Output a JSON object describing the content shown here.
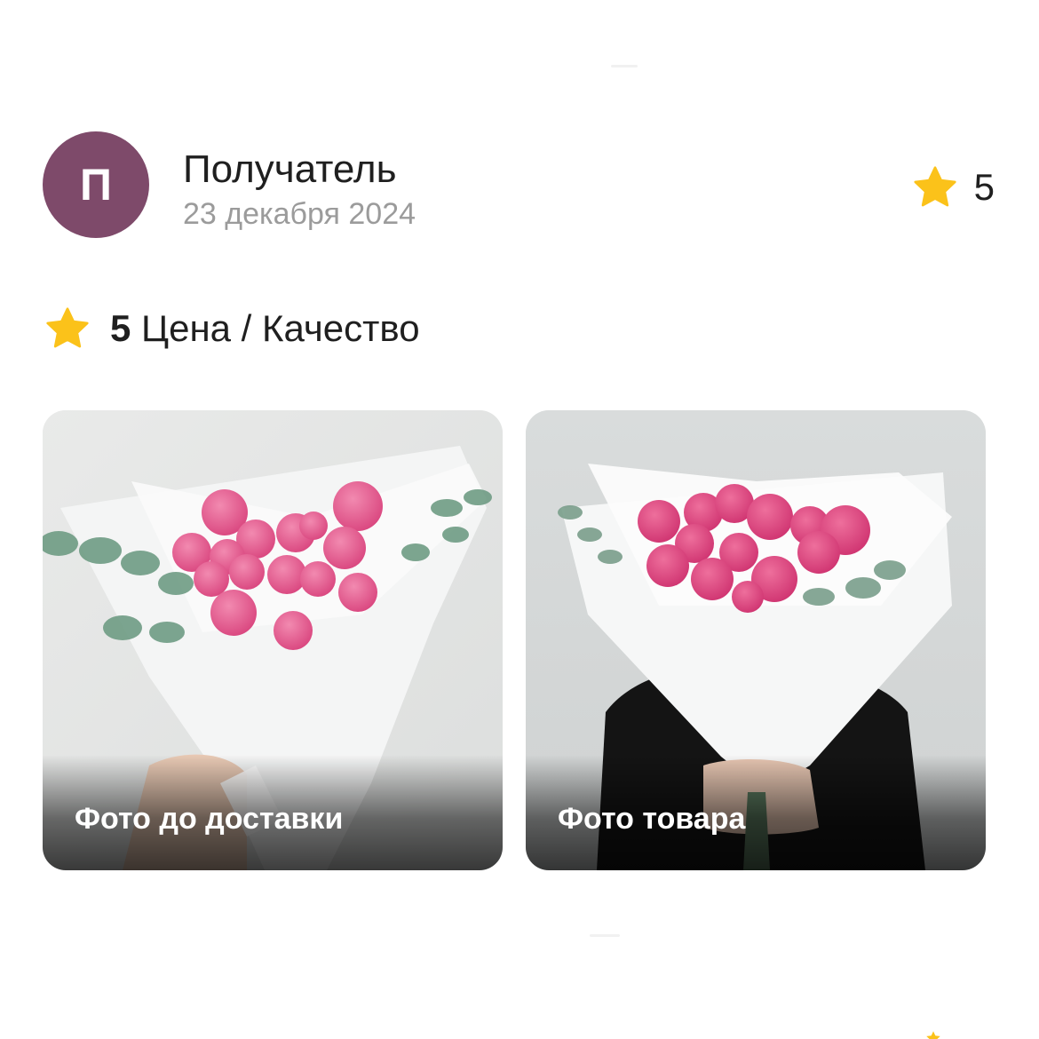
{
  "review": {
    "avatar_letter": "П",
    "author": "Получатель",
    "date": "23 декабря 2024",
    "rating": "5",
    "aspect": {
      "value": "5",
      "label": "Цена / Качество"
    },
    "photos": [
      {
        "caption": "Фото до доставки",
        "icon": "bouquet-photo"
      },
      {
        "caption": "Фото товара",
        "icon": "bouquet-photo"
      }
    ]
  },
  "colors": {
    "avatar_bg": "#7e4a6a",
    "star": "#fbc21a",
    "date_text": "#9b9b9b",
    "primary_text": "#1f1f1f"
  }
}
